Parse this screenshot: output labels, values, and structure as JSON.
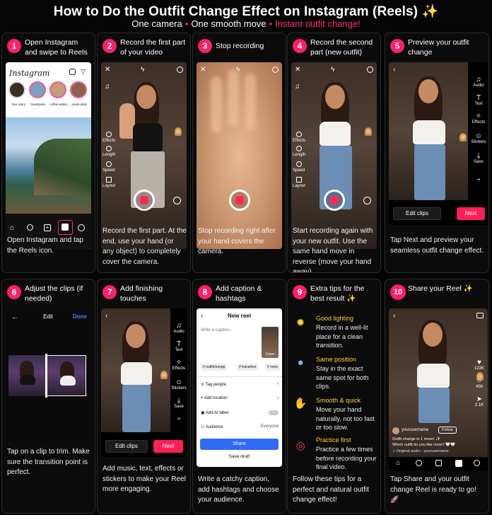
{
  "header": {
    "title": "How to Do the Outfit Change Effect on Instagram (Reels) ✨",
    "sub_1": "One camera",
    "sub_2": "One smooth move",
    "sub_3": "Instant outfit change!",
    "dot": "•"
  },
  "steps": [
    {
      "num": "1",
      "title": "Open Instagram and swipe to Reels",
      "desc": "Open Instagram and tap the Reels icon."
    },
    {
      "num": "2",
      "title": "Record the first part of your video",
      "desc": "Record the first part. At the end, use your hand (or any object) to completely cover the camera."
    },
    {
      "num": "3",
      "title": "Stop recording",
      "desc": "Stop recording right after your hand covers the camera."
    },
    {
      "num": "4",
      "title": "Record the second part (new outfit)",
      "desc": "Start recording again with your new outfit. Use the same hand move in reverse (move your hand away)."
    },
    {
      "num": "5",
      "title": "Preview your outfit change",
      "desc": "Tap Next and preview your seamless outfit change effect."
    },
    {
      "num": "6",
      "title": "Adjust the clips (if needed)",
      "desc": "Tap on a clip to trim. Make sure the transition point is perfect."
    },
    {
      "num": "7",
      "title": "Add finishing touches",
      "desc": "Add music, text, effects or stickers to make your Reel more engaging."
    },
    {
      "num": "8",
      "title": "Add caption & hashtags",
      "desc": "Write a catchy caption, add hashtags and choose your audience."
    },
    {
      "num": "9",
      "title": "Extra tips for the best result ✨",
      "desc": "Follow these tips for a perfect and natural outfit change effect!"
    },
    {
      "num": "10",
      "title": "Share your Reel ✨",
      "desc": "Tap Share and your outfit change Reel is ready to go! 🚀"
    }
  ],
  "instagram": {
    "logo": "Instagram",
    "stories": [
      "Your story",
      "travelgram",
      "coffee.addict",
      "sarah.daily"
    ]
  },
  "camera_tools": [
    "Effects",
    "Length",
    "Speed",
    "Layout"
  ],
  "camera_tools_4": [
    "Effects",
    "Length",
    "Speed",
    "Layout"
  ],
  "preview_tools": [
    "Audio",
    "Text",
    "Effects",
    "Stickers",
    "Save"
  ],
  "buttons": {
    "edit_clips": "Edit clips",
    "next": "Next",
    "edit": "Edit",
    "done": "Done",
    "share": "Share",
    "save_draft": "Save draft",
    "follow": "Follow"
  },
  "new_reel": {
    "title": "New reel",
    "caption_placeholder": "Write a caption...",
    "cover": "Cover",
    "hashtags": [
      "# outfitchange",
      "# transition",
      "# reels"
    ],
    "rows": [
      "Tag people",
      "Add location",
      "Add AI label",
      "Audience"
    ],
    "audience_value": "Everyone"
  },
  "tips": [
    {
      "icon": "bulb-icon",
      "head": "Good lighting",
      "text": "Record in a well-lit place for a clean transition."
    },
    {
      "icon": "person-icon",
      "head": "Same position",
      "text": "Stay in the exact same spot for both clips."
    },
    {
      "icon": "hand-icon",
      "head": "Smooth & quick",
      "text": "Move your hand naturally, not too fast or too slow."
    },
    {
      "icon": "target-icon",
      "head": "Practice first",
      "text": "Practice a few times before recording your final video."
    }
  ],
  "reel": {
    "username": "yourusername",
    "caption": "Outfit change in 1 move! ✨",
    "caption2": "Which outfit do you like more? 🤍🤍",
    "audio": "♫ Original audio - yourusername",
    "likes": "123K",
    "comments": "456",
    "shares": "2.1K"
  },
  "colors": {
    "accent": "#ff1f6a",
    "tip_heading": "#ffcf33",
    "share_blue": "#2f6cf6"
  }
}
